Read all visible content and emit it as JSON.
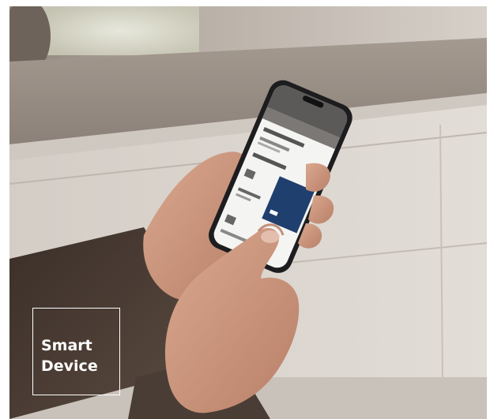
{
  "label": {
    "line1": "Smart",
    "line2": "Device"
  },
  "colors": {
    "box_border": "#ffffff",
    "text": "#ffffff",
    "phone_accent": "#1f3f6e"
  }
}
